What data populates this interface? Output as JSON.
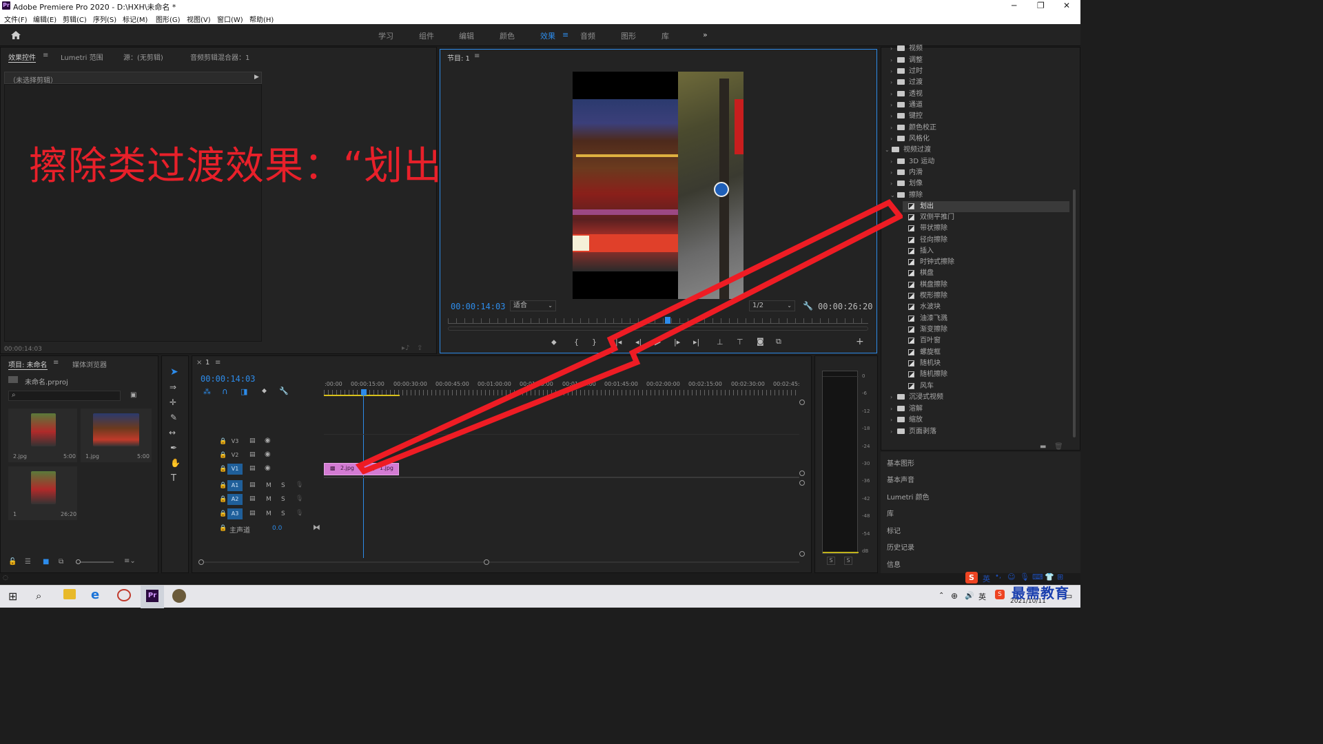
{
  "window": {
    "title": "Adobe Premiere Pro 2020 - D:\\HXH\\未命名 *",
    "app_icon": "Pr",
    "minimize": "─",
    "maximize": "❐",
    "close": "✕"
  },
  "menu": [
    "文件(F)",
    "编辑(E)",
    "剪辑(C)",
    "序列(S)",
    "标记(M)",
    "图形(G)",
    "视图(V)",
    "窗口(W)",
    "帮助(H)"
  ],
  "workspaces": {
    "tabs": [
      "学习",
      "组件",
      "编辑",
      "颜色",
      "效果",
      "音频",
      "图形",
      "库"
    ],
    "active": "效果",
    "more": "»"
  },
  "effect_controls": {
    "tabs": [
      "效果控件",
      "Lumetri 范围",
      "源：(无剪辑)",
      "音频剪辑混合器：1"
    ],
    "no_clip": "（未选择剪辑）",
    "timecode": "00:00:14:03"
  },
  "overlay_caption": "擦除类过渡效果：“划出”效果",
  "program_monitor": {
    "tab": "节目: 1",
    "timecode": "00:00:14:03",
    "fit": "适合",
    "resolution": "1/2",
    "duration": "00:00:26:20"
  },
  "project": {
    "tabs": [
      "项目: 未命名",
      "媒体浏览器"
    ],
    "file": "未命名.prproj",
    "items": [
      {
        "name": "2.jpg",
        "dur": "5:00"
      },
      {
        "name": "1.jpg",
        "dur": "5:00"
      },
      {
        "name": "1",
        "dur": "26:20"
      }
    ]
  },
  "timeline": {
    "tab": "1",
    "timecode": "00:00:14:03",
    "ruler": [
      ":00:00",
      "00:00:15:00",
      "00:00:30:00",
      "00:00:45:00",
      "00:01:00:00",
      "00:01:15:00",
      "00:01:30:00",
      "00:01:45:00",
      "00:02:00:00",
      "00:02:15:00",
      "00:02:30:00",
      "00:02:45:"
    ],
    "video_tracks": [
      "V3",
      "V2",
      "V1"
    ],
    "audio_tracks": [
      "A1",
      "A2",
      "A3"
    ],
    "master": "主声道",
    "master_value": "0.0",
    "clips": [
      "2.jpg",
      "1.jpg"
    ],
    "mute": "M",
    "solo": "S"
  },
  "meter": {
    "scale": [
      "0",
      "-6",
      "-12",
      "-18",
      "-24",
      "-30",
      "-36",
      "-42",
      "-48",
      "-54",
      "dB"
    ],
    "solo": [
      "S",
      "S"
    ]
  },
  "effects_tree": {
    "top": [
      "视频",
      "调整",
      "过时",
      "过渡",
      "透视",
      "通道",
      "键控",
      "颜色校正",
      "风格化"
    ],
    "video_transitions": "视频过渡",
    "transition_groups_before": [
      "3D 运动",
      "内滑",
      "划像"
    ],
    "wipe_group": "擦除",
    "wipe_items": [
      "划出",
      "双侧平推门",
      "带状擦除",
      "径向擦除",
      "插入",
      "时钟式擦除",
      "棋盘",
      "棋盘擦除",
      "楔形擦除",
      "水波块",
      "油漆飞溅",
      "渐变擦除",
      "百叶窗",
      "螺旋框",
      "随机块",
      "随机擦除",
      "风车"
    ],
    "transition_groups_after": [
      "沉浸式视频",
      "溶解",
      "缩放",
      "页面剥落"
    ],
    "selected": "划出"
  },
  "right_panels": [
    "基本图形",
    "基本声音",
    "Lumetri 颜色",
    "库",
    "标记",
    "历史记录",
    "信息"
  ],
  "taskbar": {
    "date": "2021/10/11",
    "ime": "英",
    "watermark": "最需教育"
  }
}
